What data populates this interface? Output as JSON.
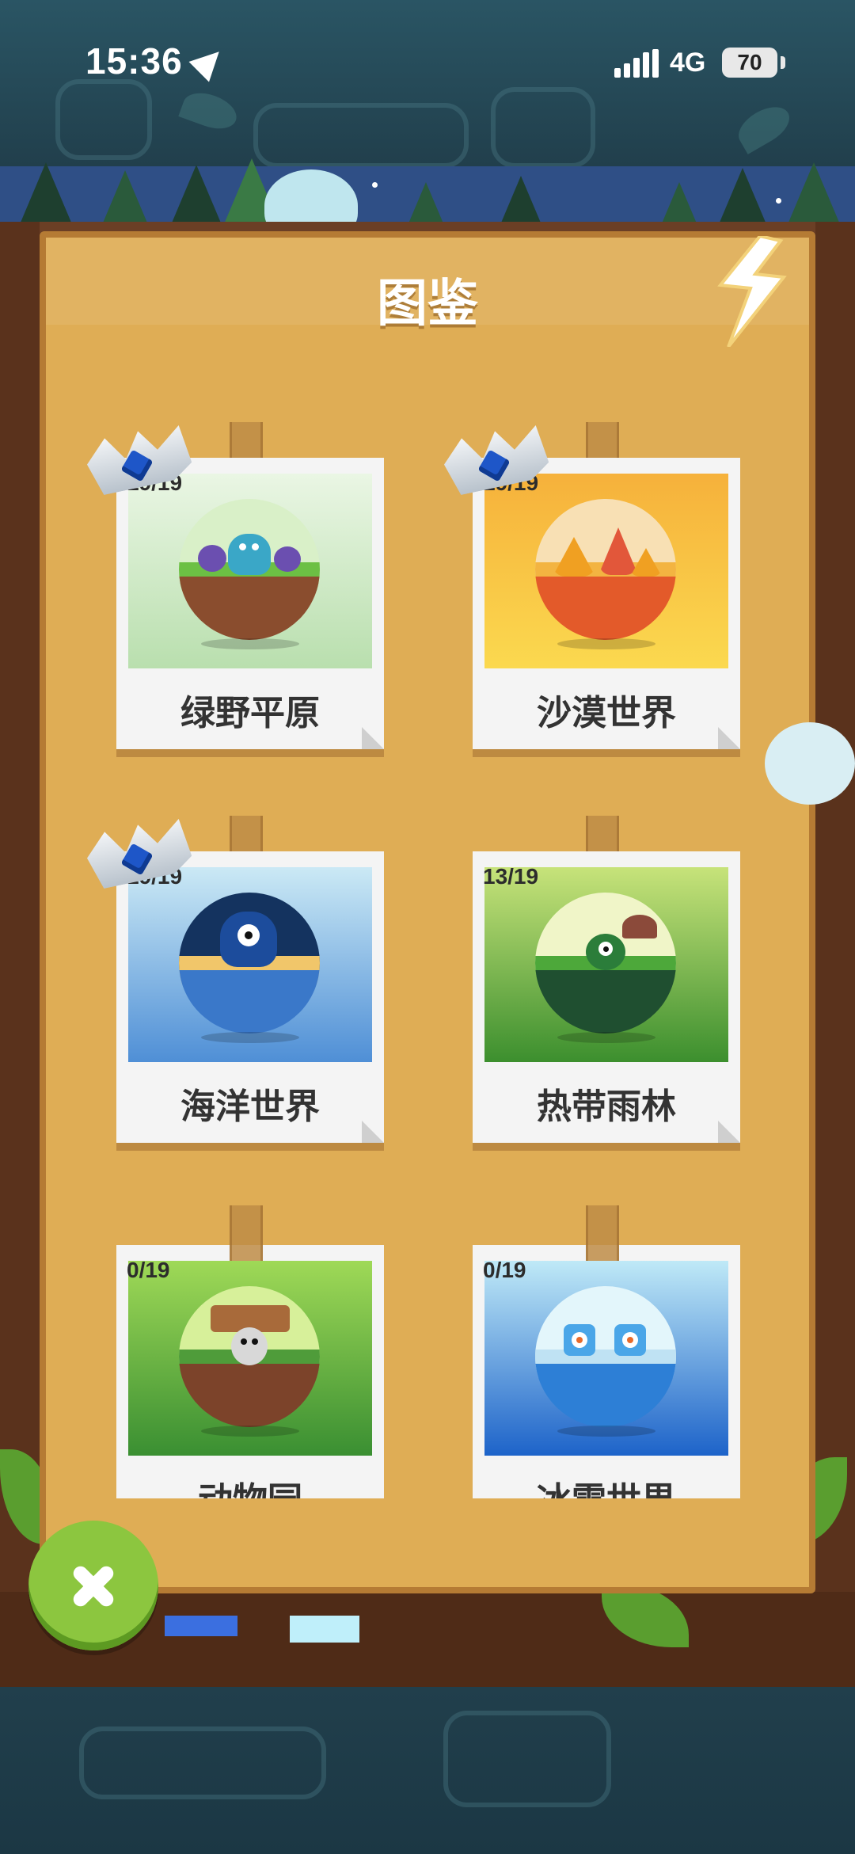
{
  "status_bar": {
    "time": "15:36",
    "network": "4G",
    "battery": "70"
  },
  "header": {
    "title": "图鉴"
  },
  "worlds": [
    {
      "name": "绿野平原",
      "progress": "19/19",
      "crowned": true,
      "theme": "grassland"
    },
    {
      "name": "沙漠世界",
      "progress": "19/19",
      "crowned": true,
      "theme": "desert"
    },
    {
      "name": "海洋世界",
      "progress": "19/19",
      "crowned": true,
      "theme": "ocean"
    },
    {
      "name": "热带雨林",
      "progress": "13/19",
      "crowned": false,
      "theme": "rainforest"
    },
    {
      "name": "动物园",
      "progress": "0/19",
      "crowned": false,
      "theme": "zoo"
    },
    {
      "name": "冰雪世界",
      "progress": "0/19",
      "crowned": false,
      "theme": "snow"
    }
  ],
  "icons": {
    "location": "location-arrow-icon",
    "signal": "signal-bars-icon",
    "battery": "battery-icon",
    "close": "close-icon",
    "crown": "crown-icon",
    "lightning": "lightning-icon"
  },
  "colors": {
    "panel": "#dfad55",
    "wood": "#6b3f25",
    "close_button": "#8cc63f",
    "crown_gem": "#1e56c8"
  }
}
